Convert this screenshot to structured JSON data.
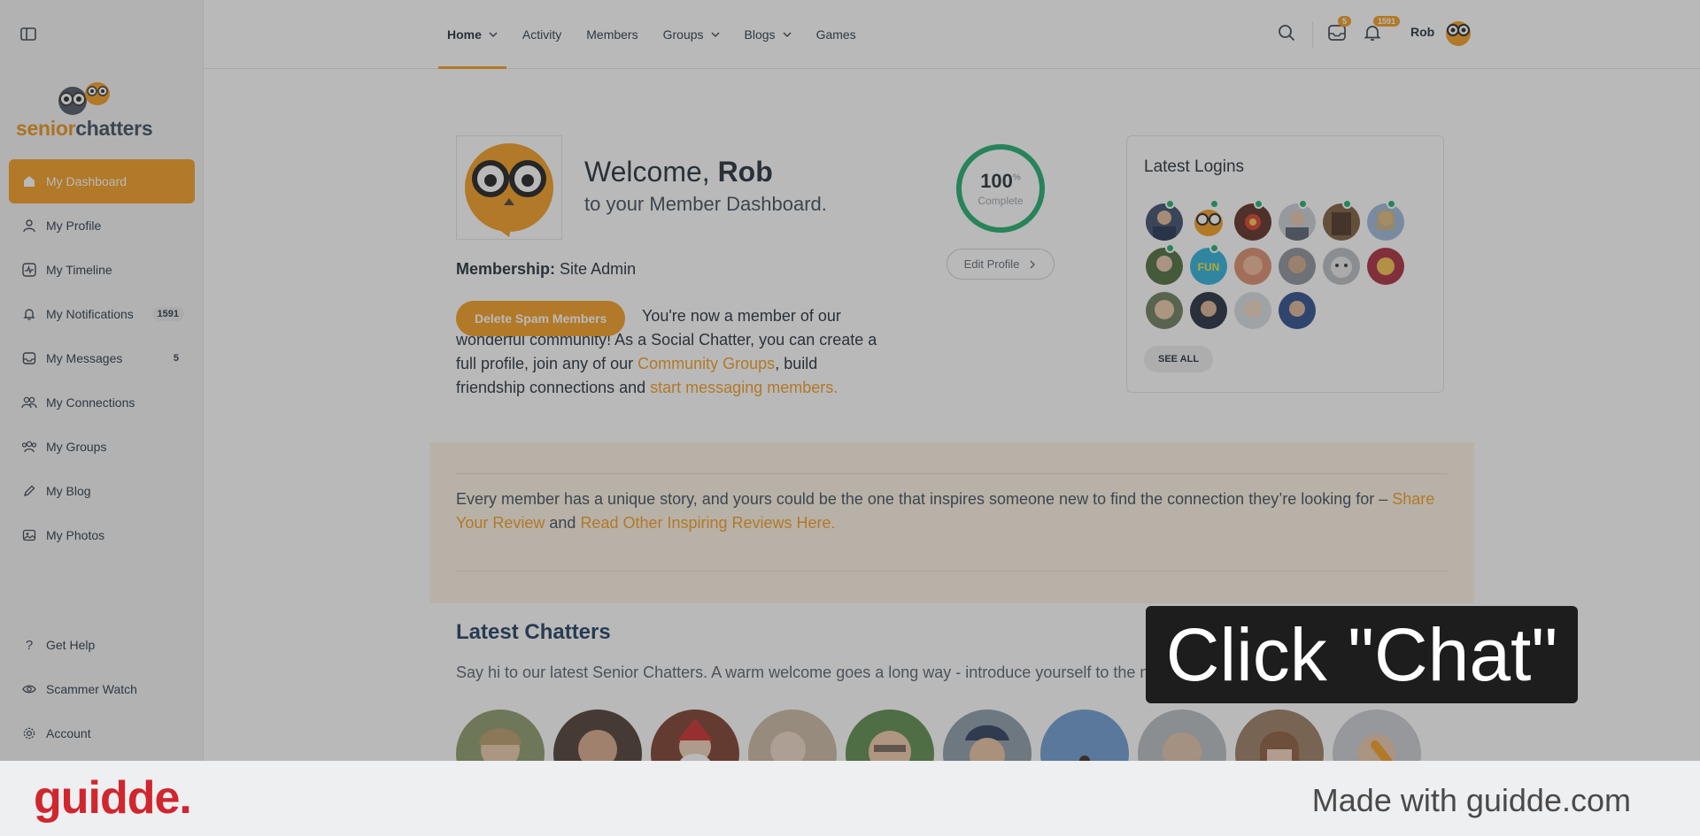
{
  "sidebar": {
    "brand_part1": "senior",
    "brand_part2": "chatters",
    "items": [
      {
        "label": "My Dashboard",
        "icon": "home-icon"
      },
      {
        "label": "My Profile",
        "icon": "user-icon"
      },
      {
        "label": "My Timeline",
        "icon": "activity-icon"
      },
      {
        "label": "My Notifications",
        "icon": "bell-icon",
        "count": "1591"
      },
      {
        "label": "My Messages",
        "icon": "inbox-icon",
        "count": "5"
      },
      {
        "label": "My Connections",
        "icon": "users-icon"
      },
      {
        "label": "My Groups",
        "icon": "groups-icon"
      },
      {
        "label": "My Blog",
        "icon": "pencil-icon"
      },
      {
        "label": "My Photos",
        "icon": "photo-icon"
      }
    ],
    "bottom_items": [
      {
        "label": "Get Help",
        "icon": "question-icon"
      },
      {
        "label": "Scammer Watch",
        "icon": "eye-icon"
      },
      {
        "label": "Account",
        "icon": "gear-icon"
      }
    ]
  },
  "topnav": {
    "items": [
      {
        "label": "Home",
        "dropdown": true
      },
      {
        "label": "Activity",
        "dropdown": false
      },
      {
        "label": "Members",
        "dropdown": false
      },
      {
        "label": "Groups",
        "dropdown": true
      },
      {
        "label": "Blogs",
        "dropdown": true
      },
      {
        "label": "Games",
        "dropdown": false
      }
    ],
    "messages_badge": "5",
    "notifications_badge": "1591",
    "username": "Rob"
  },
  "welcome": {
    "title_prefix": "Welcome, ",
    "name": "Rob",
    "subtitle": "to your Member Dashboard.",
    "membership_label": "Membership:",
    "membership_value": "Site Admin",
    "spam_button": "Delete Spam Members",
    "intro_1": "You're now a member of our wonderful community! As a Social Chatter, you can create a full profile, join any of our ",
    "intro_link1": "Community Groups",
    "intro_2": ", build friendship connections and ",
    "intro_link2": "start messaging members."
  },
  "profile_progress": {
    "value": "100",
    "unit": "%",
    "label": "Complete",
    "percent": 100,
    "edit_button": "Edit Profile"
  },
  "latest_logins": {
    "title": "Latest Logins",
    "see_all": "SEE ALL"
  },
  "review": {
    "text_1": "Every member has a unique story, and yours could be the one that inspires someone new to find the connection they’re looking for – ",
    "link1": "Share Your Review",
    "text_2": " and ",
    "link2": "Read Other Inspiring Reviews Here."
  },
  "latest_chatters": {
    "title": "Latest Chatters",
    "subtitle": "Say hi to our latest Senior Chatters. A warm welcome goes a long way - introduce yourself to the newest members of our community!"
  },
  "callout": {
    "text": "Click \"Chat\""
  },
  "footer": {
    "logo": "guidde.",
    "made_with": "Made with guidde.com"
  },
  "colors": {
    "accent": "#f39b1d",
    "online": "#1bab6b",
    "heading_blue": "#1c3a5e",
    "guidde_red": "#d0262d"
  }
}
